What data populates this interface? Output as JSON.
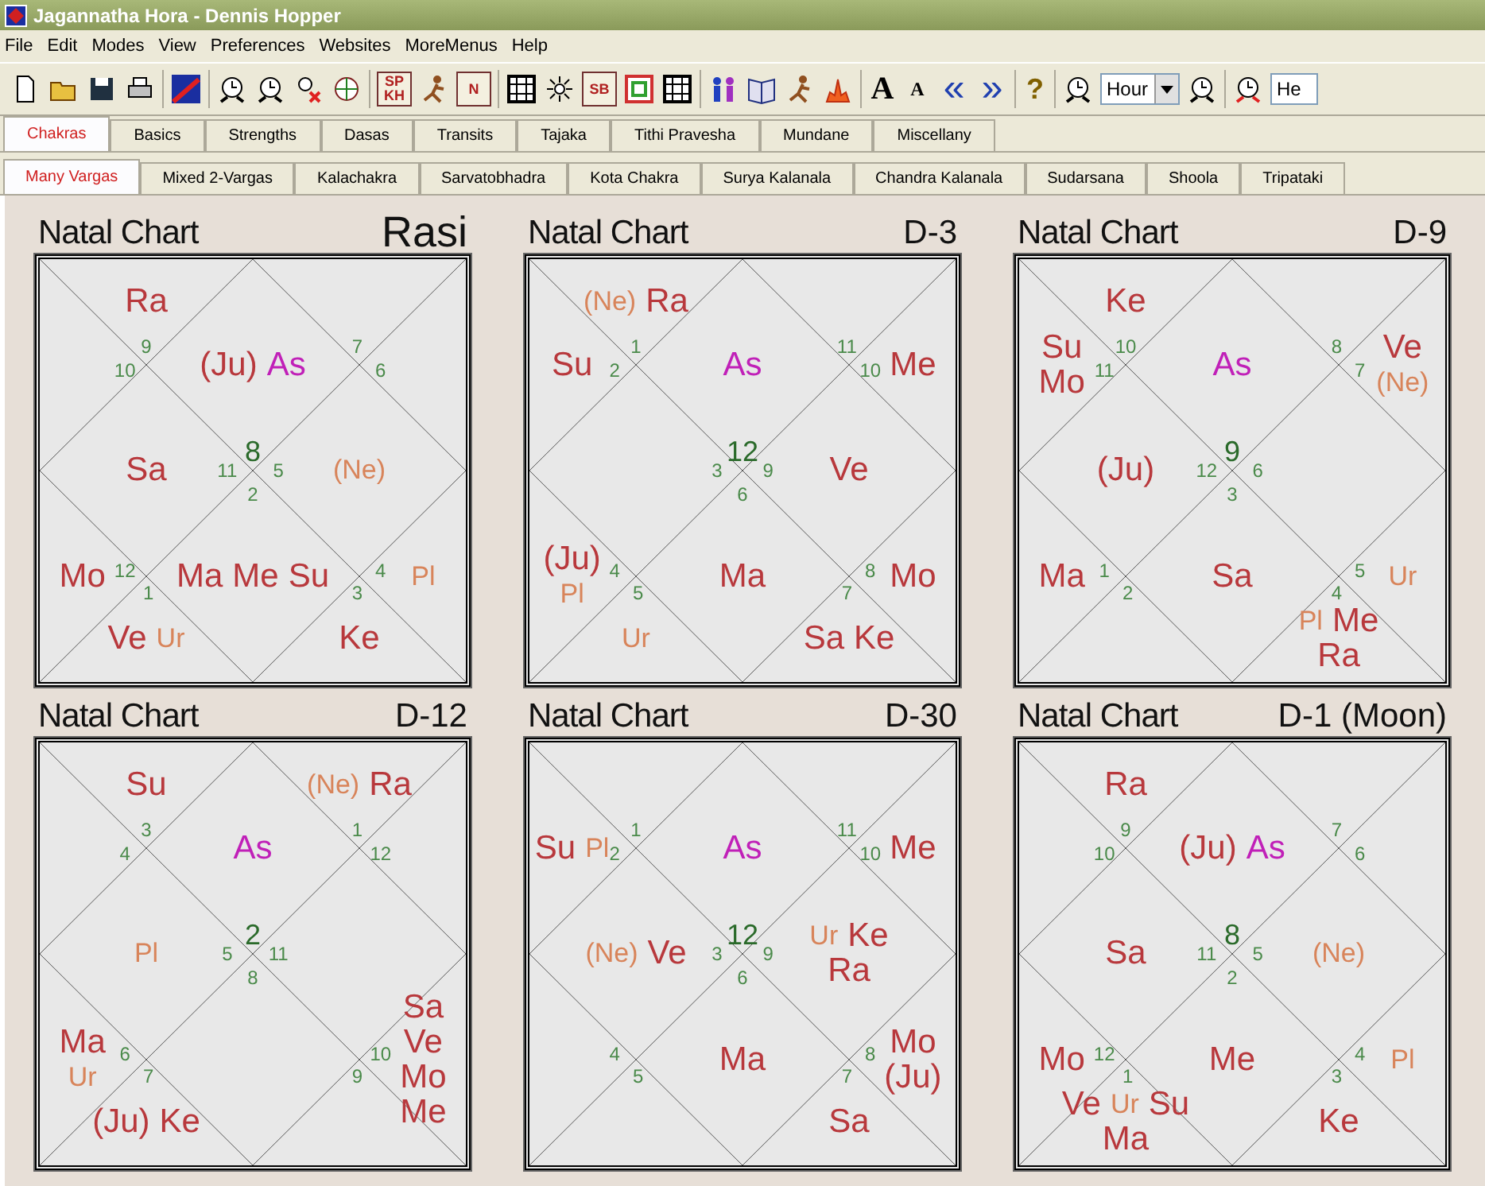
{
  "window": {
    "title": "Jagannatha Hora - Dennis Hopper"
  },
  "menu": [
    "File",
    "Edit",
    "Modes",
    "View",
    "Preferences",
    "Websites",
    "MoreMenus",
    "Help"
  ],
  "toolbar": [
    {
      "kind": "doc"
    },
    {
      "kind": "folder"
    },
    {
      "kind": "disk"
    },
    {
      "kind": "printer"
    },
    {
      "kind": "sep"
    },
    {
      "kind": "chartmap"
    },
    {
      "kind": "sep"
    },
    {
      "kind": "clock"
    },
    {
      "kind": "clock"
    },
    {
      "kind": "personx"
    },
    {
      "kind": "globe"
    },
    {
      "kind": "sep"
    },
    {
      "kind": "boxtext",
      "text": "SP KH"
    },
    {
      "kind": "figure"
    },
    {
      "kind": "boxtext",
      "text": "N"
    },
    {
      "kind": "sep"
    },
    {
      "kind": "grid"
    },
    {
      "kind": "sun"
    },
    {
      "kind": "boxtext",
      "text": "SB"
    },
    {
      "kind": "rings"
    },
    {
      "kind": "grid"
    },
    {
      "kind": "sep"
    },
    {
      "kind": "people"
    },
    {
      "kind": "book"
    },
    {
      "kind": "figure"
    },
    {
      "kind": "fire"
    },
    {
      "kind": "sep"
    },
    {
      "kind": "letter",
      "text": "A"
    },
    {
      "kind": "letter_small",
      "text": "A"
    },
    {
      "kind": "arrow",
      "text": "«"
    },
    {
      "kind": "arrow",
      "text": "»"
    },
    {
      "kind": "sep"
    },
    {
      "kind": "help",
      "text": "?"
    },
    {
      "kind": "sep"
    },
    {
      "kind": "clock"
    },
    {
      "kind": "dropdown",
      "text": "Hour"
    },
    {
      "kind": "clock"
    },
    {
      "kind": "sep"
    },
    {
      "kind": "clockx"
    },
    {
      "kind": "field",
      "text": "He"
    }
  ],
  "tabs": [
    {
      "label": "Chakras",
      "selected": true
    },
    {
      "label": "Basics",
      "selected": false
    },
    {
      "label": "Strengths",
      "selected": false
    },
    {
      "label": "Dasas",
      "selected": false
    },
    {
      "label": "Transits",
      "selected": false
    },
    {
      "label": "Tajaka",
      "selected": false
    },
    {
      "label": "Tithi Pravesha",
      "selected": false
    },
    {
      "label": "Mundane",
      "selected": false
    },
    {
      "label": "Miscellany",
      "selected": false
    }
  ],
  "subtabs": [
    {
      "label": "Many Vargas",
      "selected": true
    },
    {
      "label": "Mixed 2-Vargas",
      "selected": false
    },
    {
      "label": "Kalachakra",
      "selected": false
    },
    {
      "label": "Sarvatobhadra",
      "selected": false
    },
    {
      "label": "Kota Chakra",
      "selected": false
    },
    {
      "label": "Surya Kalanala",
      "selected": false
    },
    {
      "label": "Chandra Kalanala",
      "selected": false
    },
    {
      "label": "Sudarsana",
      "selected": false
    },
    {
      "label": "Shoola",
      "selected": false
    },
    {
      "label": "Tripataki",
      "selected": false
    }
  ],
  "charts": [
    {
      "title": "Natal Chart",
      "name": "Rasi",
      "name_large": true,
      "houses": [
        {
          "kind": "second",
          "sign": "9",
          "planets": [
            {
              "text": "Ra",
              "kind": "planet"
            }
          ]
        },
        {
          "kind": "twelfth",
          "sign": "7"
        },
        {
          "kind": "third",
          "sign": "10"
        },
        {
          "kind": "first",
          "sign": "8",
          "planets": [
            {
              "text": "(Ju)",
              "kind": "planet"
            },
            {
              "text": "As",
              "kind": "ascendant"
            }
          ]
        },
        {
          "kind": "eleventh",
          "sign": "6"
        },
        {
          "kind": "fourth",
          "sign": "11",
          "planets": [
            {
              "text": "Sa",
              "kind": "planet"
            }
          ]
        },
        {
          "kind": "tenth",
          "sign": "5",
          "planets": [
            {
              "text": "(Ne)",
              "kind": "outer"
            }
          ]
        },
        {
          "kind": "fifth",
          "sign": "12",
          "planets": [
            {
              "text": "Mo",
              "kind": "planet"
            }
          ]
        },
        {
          "kind": "seventh",
          "sign": "2",
          "planets": [
            {
              "text": "Ma",
              "kind": "planet"
            },
            {
              "text": "Me",
              "kind": "planet"
            },
            {
              "text": "Su",
              "kind": "planet"
            }
          ]
        },
        {
          "kind": "ninth",
          "sign": "4",
          "planets": [
            {
              "text": "Pl",
              "kind": "outer"
            }
          ]
        },
        {
          "kind": "sixth",
          "sign": "1",
          "planets": [
            {
              "text": "Ve",
              "kind": "planet"
            },
            {
              "text": "Ur",
              "kind": "outer"
            }
          ]
        },
        {
          "kind": "eighth",
          "sign": "3",
          "planets": [
            {
              "text": "Ke",
              "kind": "planet"
            }
          ]
        }
      ]
    },
    {
      "title": "Natal Chart",
      "name": "D-3",
      "name_large": false,
      "houses": [
        {
          "kind": "second",
          "sign": "1",
          "planets": [
            {
              "text": "(Ne)",
              "kind": "outer"
            },
            {
              "text": "Ra",
              "kind": "planet"
            }
          ]
        },
        {
          "kind": "twelfth",
          "sign": "11"
        },
        {
          "kind": "third",
          "sign": "2",
          "planets": [
            {
              "text": "Su",
              "kind": "planet"
            }
          ]
        },
        {
          "kind": "first",
          "sign": "12",
          "planets": [
            {
              "text": "As",
              "kind": "ascendant"
            }
          ]
        },
        {
          "kind": "eleventh",
          "sign": "10",
          "planets": [
            {
              "text": "Me",
              "kind": "planet"
            }
          ]
        },
        {
          "kind": "fourth",
          "sign": "3"
        },
        {
          "kind": "tenth",
          "sign": "9",
          "planets": [
            {
              "text": "Ve",
              "kind": "planet"
            }
          ]
        },
        {
          "kind": "fifth",
          "sign": "4",
          "planets": [
            {
              "text": "(Ju)",
              "kind": "planet"
            },
            {
              "text": "Pl",
              "kind": "outer"
            }
          ]
        },
        {
          "kind": "seventh",
          "sign": "6",
          "planets": [
            {
              "text": "Ma",
              "kind": "planet"
            }
          ]
        },
        {
          "kind": "ninth",
          "sign": "8",
          "planets": [
            {
              "text": "Mo",
              "kind": "planet"
            }
          ]
        },
        {
          "kind": "sixth",
          "sign": "5",
          "planets": [
            {
              "text": "Ur",
              "kind": "outer"
            }
          ]
        },
        {
          "kind": "eighth",
          "sign": "7",
          "planets": [
            {
              "text": "Sa",
              "kind": "planet"
            },
            {
              "text": "Ke",
              "kind": "planet"
            }
          ]
        }
      ]
    },
    {
      "title": "Natal Chart",
      "name": "D-9",
      "name_large": false,
      "houses": [
        {
          "kind": "second",
          "sign": "10",
          "planets": [
            {
              "text": "Ke",
              "kind": "planet"
            }
          ]
        },
        {
          "kind": "third",
          "sign": "11",
          "planets": [
            {
              "text": "Su",
              "kind": "planet"
            },
            {
              "text": "Mo",
              "kind": "planet"
            }
          ]
        },
        {
          "kind": "twelfth",
          "sign": "8"
        },
        {
          "kind": "first",
          "sign": "9",
          "planets": [
            {
              "text": "As",
              "kind": "ascendant"
            }
          ]
        },
        {
          "kind": "eleventh",
          "sign": "7",
          "planets": [
            {
              "text": "Ve",
              "kind": "planet"
            },
            {
              "text": "(Ne)",
              "kind": "outer"
            }
          ]
        },
        {
          "kind": "fourth",
          "sign": "12",
          "planets": [
            {
              "text": "(Ju)",
              "kind": "planet"
            }
          ]
        },
        {
          "kind": "tenth",
          "sign": "6"
        },
        {
          "kind": "fifth",
          "sign": "1",
          "planets": [
            {
              "text": "Ma",
              "kind": "planet"
            }
          ]
        },
        {
          "kind": "seventh",
          "sign": "3",
          "planets": [
            {
              "text": "Sa",
              "kind": "planet"
            }
          ]
        },
        {
          "kind": "ninth",
          "sign": "5",
          "planets": [
            {
              "text": "Ur",
              "kind": "outer"
            }
          ]
        },
        {
          "kind": "sixth",
          "sign": "2"
        },
        {
          "kind": "eighth",
          "sign": "4",
          "planets": [
            {
              "text": "Pl",
              "kind": "outer"
            },
            {
              "text": "Me",
              "kind": "planet"
            },
            {
              "text": "Ra",
              "kind": "planet"
            }
          ]
        }
      ]
    },
    {
      "title": "Natal Chart",
      "name": "D-12",
      "name_large": false,
      "houses": [
        {
          "kind": "second",
          "sign": "3",
          "planets": [
            {
              "text": "Su",
              "kind": "planet"
            }
          ]
        },
        {
          "kind": "twelfth",
          "sign": "1",
          "planets": [
            {
              "text": "(Ne)",
              "kind": "outer"
            },
            {
              "text": "Ra",
              "kind": "planet"
            }
          ]
        },
        {
          "kind": "third",
          "sign": "4"
        },
        {
          "kind": "first",
          "sign": "2",
          "planets": [
            {
              "text": "As",
              "kind": "ascendant"
            }
          ]
        },
        {
          "kind": "eleventh",
          "sign": "12"
        },
        {
          "kind": "fourth",
          "sign": "5",
          "planets": [
            {
              "text": "Pl",
              "kind": "outer"
            }
          ]
        },
        {
          "kind": "tenth",
          "sign": "11"
        },
        {
          "kind": "fifth",
          "sign": "6",
          "planets": [
            {
              "text": "Ma",
              "kind": "planet"
            },
            {
              "text": "Ur",
              "kind": "outer"
            }
          ]
        },
        {
          "kind": "seventh",
          "sign": "8"
        },
        {
          "kind": "ninth",
          "sign": "10",
          "planets": [
            {
              "text": "Sa",
              "kind": "planet"
            },
            {
              "text": "Ve",
              "kind": "planet"
            },
            {
              "text": "Mo",
              "kind": "planet"
            },
            {
              "text": "Me",
              "kind": "planet"
            }
          ]
        },
        {
          "kind": "sixth",
          "sign": "7",
          "planets": [
            {
              "text": "(Ju)",
              "kind": "planet"
            },
            {
              "text": "Ke",
              "kind": "planet"
            }
          ]
        },
        {
          "kind": "eighth",
          "sign": "9"
        }
      ]
    },
    {
      "title": "Natal Chart",
      "name": "D-30",
      "name_large": false,
      "houses": [
        {
          "kind": "second",
          "sign": "1"
        },
        {
          "kind": "twelfth",
          "sign": "11"
        },
        {
          "kind": "third",
          "sign": "2",
          "planets": [
            {
              "text": "Su",
              "kind": "planet"
            },
            {
              "text": "Pl",
              "kind": "outer"
            }
          ]
        },
        {
          "kind": "first",
          "sign": "12",
          "planets": [
            {
              "text": "As",
              "kind": "ascendant"
            }
          ]
        },
        {
          "kind": "eleventh",
          "sign": "10",
          "planets": [
            {
              "text": "Me",
              "kind": "planet"
            }
          ]
        },
        {
          "kind": "fourth",
          "sign": "3",
          "planets": [
            {
              "text": "(Ne)",
              "kind": "outer"
            },
            {
              "text": "Ve",
              "kind": "planet"
            }
          ]
        },
        {
          "kind": "tenth",
          "sign": "9",
          "planets": [
            {
              "text": "Ur",
              "kind": "outer"
            },
            {
              "text": "Ke",
              "kind": "planet"
            },
            {
              "text": "Ra",
              "kind": "planet"
            }
          ]
        },
        {
          "kind": "fifth",
          "sign": "4"
        },
        {
          "kind": "seventh",
          "sign": "6",
          "planets": [
            {
              "text": "Ma",
              "kind": "planet"
            }
          ]
        },
        {
          "kind": "ninth",
          "sign": "8",
          "planets": [
            {
              "text": "Mo",
              "kind": "planet"
            },
            {
              "text": "(Ju)",
              "kind": "planet"
            }
          ]
        },
        {
          "kind": "sixth",
          "sign": "5"
        },
        {
          "kind": "eighth",
          "sign": "7",
          "planets": [
            {
              "text": "Sa",
              "kind": "planet"
            }
          ]
        }
      ]
    },
    {
      "title": "Natal Chart",
      "name": "D-1 (Moon)",
      "name_large": false,
      "houses": [
        {
          "kind": "second",
          "sign": "9",
          "planets": [
            {
              "text": "Ra",
              "kind": "planet"
            }
          ]
        },
        {
          "kind": "twelfth",
          "sign": "7"
        },
        {
          "kind": "third",
          "sign": "10"
        },
        {
          "kind": "first",
          "sign": "8",
          "planets": [
            {
              "text": "(Ju)",
              "kind": "planet"
            },
            {
              "text": "As",
              "kind": "ascendant"
            }
          ]
        },
        {
          "kind": "eleventh",
          "sign": "6"
        },
        {
          "kind": "fourth",
          "sign": "11",
          "planets": [
            {
              "text": "Sa",
              "kind": "planet"
            }
          ]
        },
        {
          "kind": "tenth",
          "sign": "5",
          "planets": [
            {
              "text": "(Ne)",
              "kind": "outer"
            }
          ]
        },
        {
          "kind": "fifth",
          "sign": "12",
          "planets": [
            {
              "text": "Mo",
              "kind": "planet"
            }
          ]
        },
        {
          "kind": "seventh",
          "sign": "2",
          "planets": [
            {
              "text": "Me",
              "kind": "planet"
            }
          ]
        },
        {
          "kind": "ninth",
          "sign": "4",
          "planets": [
            {
              "text": "Pl",
              "kind": "outer"
            }
          ]
        },
        {
          "kind": "sixth",
          "sign": "1",
          "planets": [
            {
              "text": "Ve",
              "kind": "planet"
            },
            {
              "text": "Ur",
              "kind": "outer"
            },
            {
              "text": "Su",
              "kind": "planet"
            },
            {
              "text": "Ma",
              "kind": "planet"
            }
          ]
        },
        {
          "kind": "eighth",
          "sign": "3",
          "planets": [
            {
              "text": "Ke",
              "kind": "planet"
            }
          ]
        }
      ]
    }
  ]
}
